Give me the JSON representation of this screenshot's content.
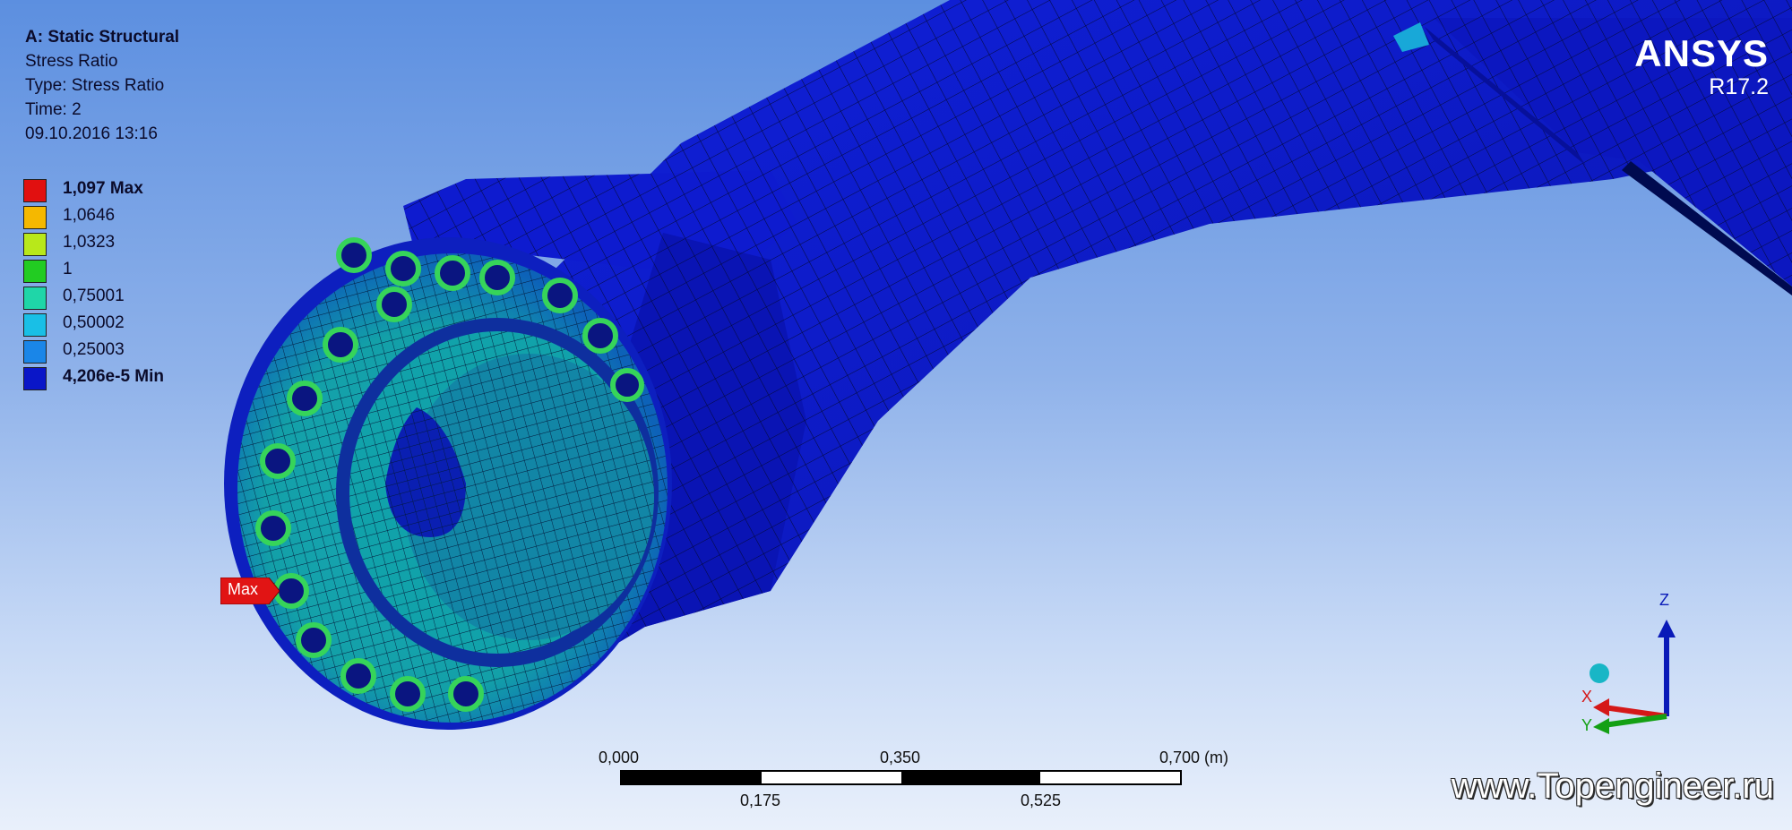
{
  "info": {
    "title": "A: Static Structural",
    "result": "Stress Ratio",
    "type": "Type: Stress Ratio",
    "time": "Time: 2",
    "date": "09.10.2016 13:16"
  },
  "legend": [
    {
      "label": "1,097 Max",
      "color": "#e11010",
      "bold": true
    },
    {
      "label": "1,0646",
      "color": "#f5b800",
      "bold": false
    },
    {
      "label": "1,0323",
      "color": "#b8e81a",
      "bold": false
    },
    {
      "label": "1",
      "color": "#22cc22",
      "bold": false
    },
    {
      "label": "0,75001",
      "color": "#1fd6a8",
      "bold": false
    },
    {
      "label": "0,50002",
      "color": "#19bfe6",
      "bold": false
    },
    {
      "label": "0,25003",
      "color": "#1a86e8",
      "bold": false
    },
    {
      "label": "4,206e-5 Min",
      "color": "#0a16c8",
      "bold": true
    }
  ],
  "logo": {
    "brand": "ANSYS",
    "version": "R17.2"
  },
  "probe": {
    "max_label": "Max"
  },
  "scale": {
    "top_labels": [
      "0,000",
      "0,350",
      "0,700 (m)"
    ],
    "bottom_labels": [
      "0,175",
      "0,525"
    ]
  },
  "triad": {
    "z": "Z",
    "x": "X",
    "y": "Y"
  },
  "watermark": "www.Topengineer.ru"
}
